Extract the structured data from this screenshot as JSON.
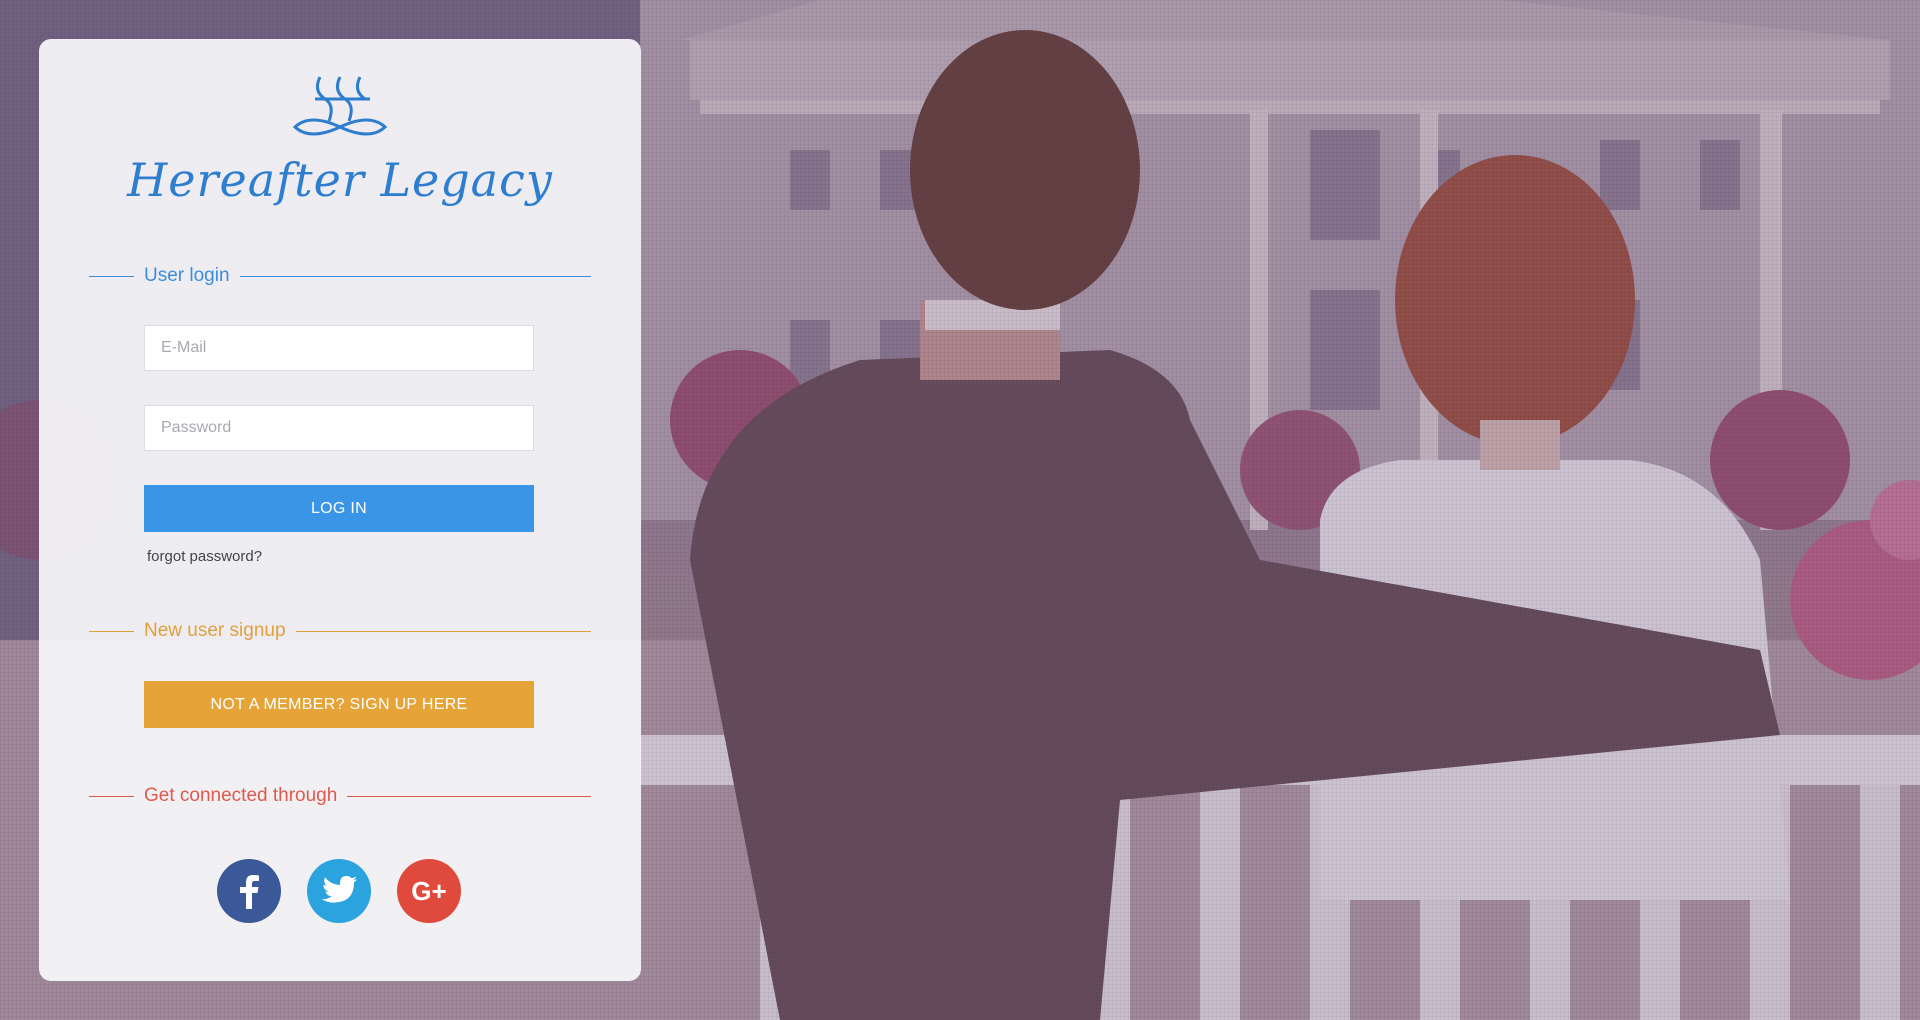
{
  "brand": {
    "name": "Hereafter Legacy",
    "logo_icon": "interlocked-h-infinity-icon",
    "color": "#2e7ed0"
  },
  "login": {
    "section_label": "User login",
    "email_placeholder": "E-Mail",
    "password_placeholder": "Password",
    "submit_label": "LOG IN",
    "forgot_label": "forgot password?",
    "accent": "#3a95e6"
  },
  "signup": {
    "section_label": "New user signup",
    "button_label": "NOT A MEMBER? SIGN UP HERE",
    "accent": "#e6a338"
  },
  "social": {
    "section_label": "Get connected through",
    "accent": "#dd5a4e",
    "items": [
      {
        "name": "facebook",
        "icon": "facebook-icon",
        "color": "#3b5998"
      },
      {
        "name": "twitter",
        "icon": "twitter-icon",
        "color": "#2aa3de"
      },
      {
        "name": "google-plus",
        "icon": "google-plus-icon",
        "glyph": "G+",
        "color": "#df4a3c"
      }
    ]
  },
  "background": {
    "description_icon": "couple-on-bench-photo"
  }
}
